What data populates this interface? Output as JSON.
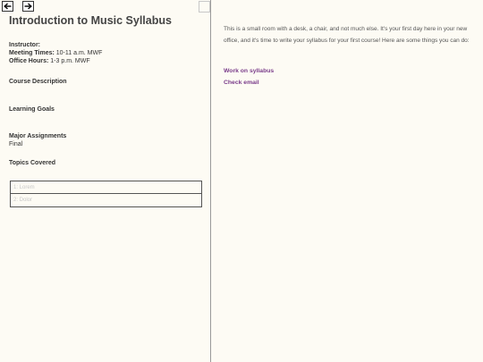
{
  "syllabus": {
    "title": "Introduction to Music Syllabus",
    "instructor_label": "Instructor:",
    "instructor_value": "",
    "meeting_label": "Meeting Times:",
    "meeting_value": " 10-11 a.m. MWF",
    "office_label": "Office Hours:",
    "office_value": " 1-3 p.m. MWF",
    "course_description_heading": "Course Description",
    "learning_goals_heading": "Learning Goals",
    "major_assignments_heading": "Major Assignments",
    "major_assignments_items": [
      "Final"
    ],
    "topics_heading": "Topics Covered",
    "topics": [
      "1: Lorem",
      "2: Dolor"
    ]
  },
  "passage": {
    "text": "This is a small room with a desk, a chair, and not much else. It's your first day here in your new office, and it's time to write your syllabus for your first course! Here are some things you can do:",
    "choices": [
      "Work on syllabus",
      "Check email"
    ]
  },
  "icons": {
    "back": "left-arrow-icon",
    "forward": "right-arrow-icon"
  },
  "colors": {
    "background": "#fdfbf4",
    "link": "#7a3c8a",
    "heading": "#444444"
  }
}
